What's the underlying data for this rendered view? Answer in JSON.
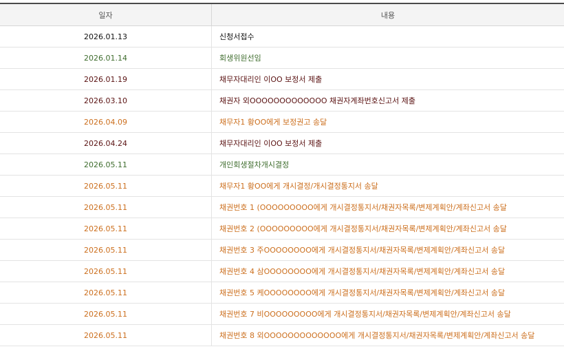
{
  "table": {
    "headers": {
      "date": "일자",
      "content": "내용"
    },
    "rows": [
      {
        "date": "2026.01.13",
        "content": "신청서접수",
        "color": "#111111"
      },
      {
        "date": "2026.01.14",
        "content": "회생위원선임",
        "color": "#3f6d2e"
      },
      {
        "date": "2026.01.19",
        "content": "채무자대리인 이OO 보정서 제출",
        "color": "#5a1212"
      },
      {
        "date": "2026.03.10",
        "content": "채권자 외OOOOOOOOOOOOO 채권자계좌번호신고서 제출",
        "color": "#5a1212"
      },
      {
        "date": "2026.04.09",
        "content": "채무자1 황OO에게 보정권고 송달",
        "color": "#cc6f1e"
      },
      {
        "date": "2026.04.24",
        "content": "채무자대리인 이OO 보정서 제출",
        "color": "#5a1212"
      },
      {
        "date": "2026.05.11",
        "content": "개인회생절차개시결정",
        "color": "#3f6d2e"
      },
      {
        "date": "2026.05.11",
        "content": "채무자1 황OO에게 개시결정/개시결정통지서 송달",
        "color": "#cc6f1e"
      },
      {
        "date": "2026.05.11",
        "content": "채권번호 1 (OOOOOOOOO에게 개시결정통지서/채권자목록/변제계획안/계좌신고서 송달",
        "color": "#cc6f1e"
      },
      {
        "date": "2026.05.11",
        "content": "채권번호 2 (OOOOOOOOO에게 개시결정통지서/채권자목록/변제계획안/계좌신고서 송달",
        "color": "#cc6f1e"
      },
      {
        "date": "2026.05.11",
        "content": "채권번호 3 주OOOOOOOO에게 개시결정통지서/채권자목록/변제계획안/계좌신고서 송달",
        "color": "#cc6f1e"
      },
      {
        "date": "2026.05.11",
        "content": "채권번호 4 삼OOOOOOOO에게 개시결정통지서/채권자목록/변제계획안/계좌신고서 송달",
        "color": "#cc6f1e"
      },
      {
        "date": "2026.05.11",
        "content": "채권번호 5 케OOOOOOOO에게 개시결정통지서/채권자목록/변제계획안/계좌신고서 송달",
        "color": "#cc6f1e"
      },
      {
        "date": "2026.05.11",
        "content": "채권번호 7 비OOOOOOOOO에게 개시결정통지서/채권자목록/변제계획안/계좌신고서 송달",
        "color": "#cc6f1e"
      },
      {
        "date": "2026.05.11",
        "content": "채권번호 8 외OOOOOOOOOOOOO에게 개시결정통지서/채권자목록/변제계획안/계좌신고서 송달",
        "color": "#cc6f1e"
      }
    ]
  }
}
